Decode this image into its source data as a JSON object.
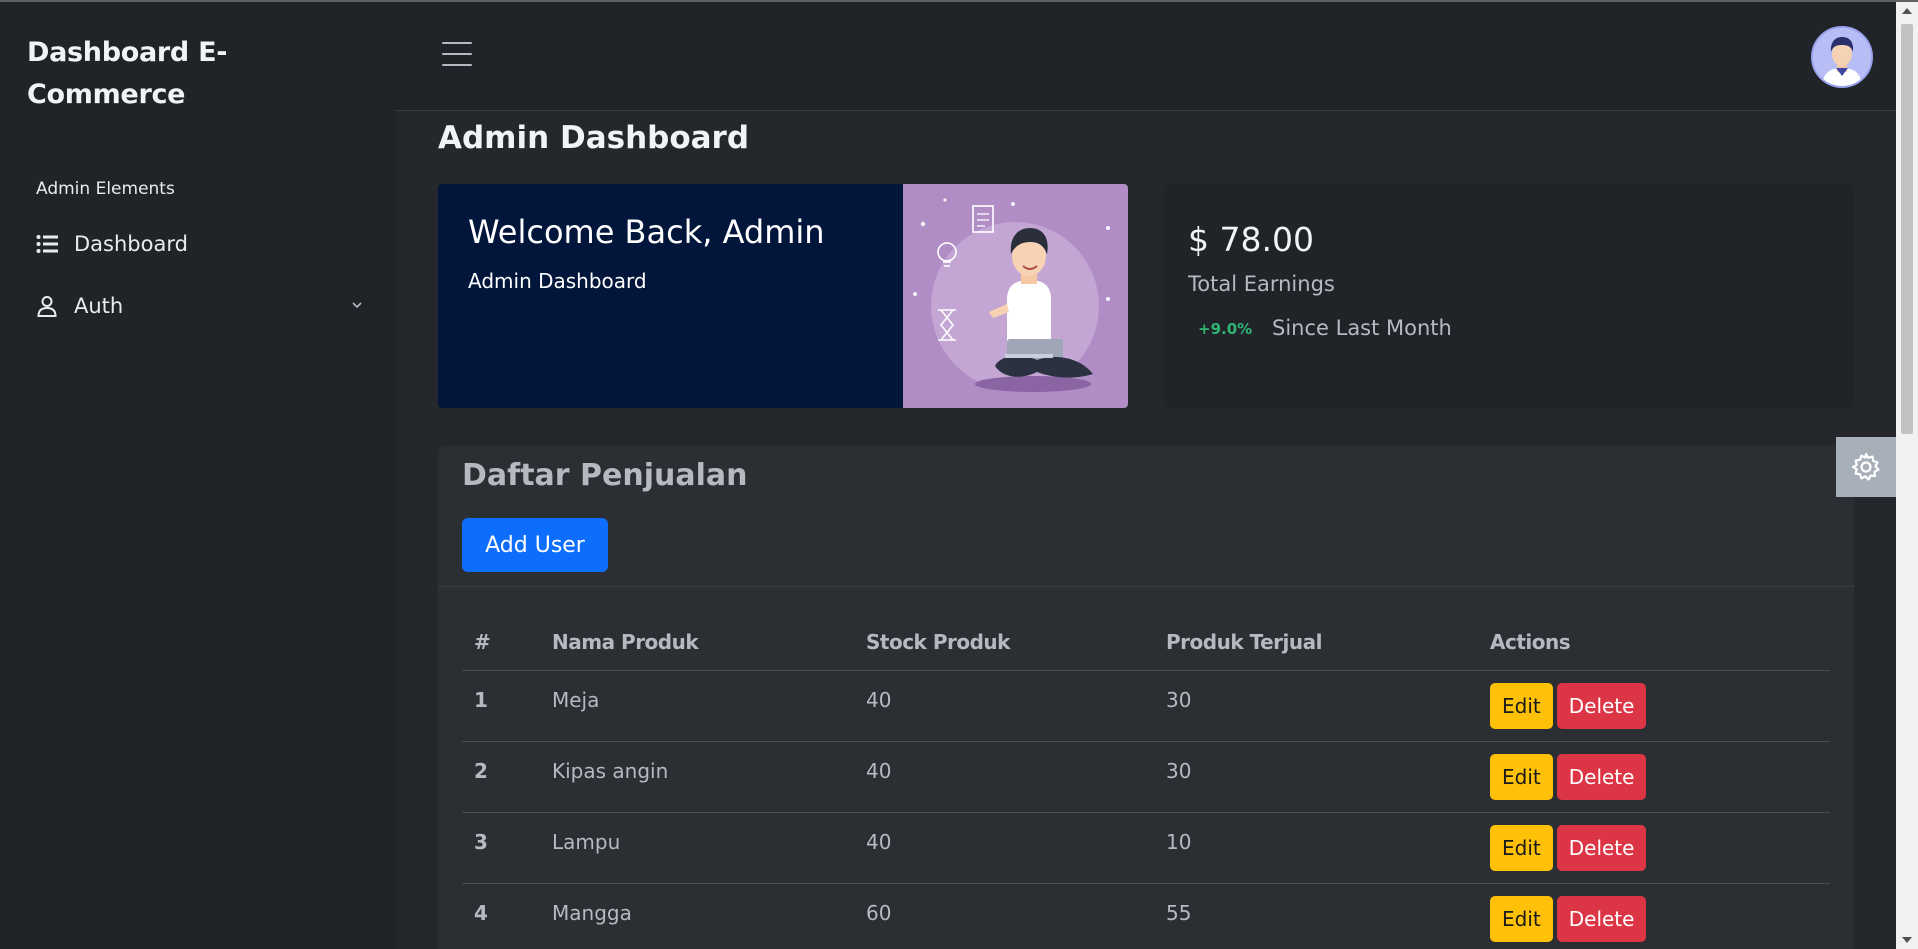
{
  "sidebar": {
    "brand": "Dashboard E-Commerce",
    "section_label": "Admin Elements",
    "items": [
      {
        "label": "Dashboard",
        "icon": "list-icon"
      },
      {
        "label": "Auth",
        "icon": "user-icon",
        "has_dropdown": true
      }
    ]
  },
  "header": {
    "menu_icon": "hamburger-icon",
    "avatar": "avatar"
  },
  "page": {
    "title": "Admin Dashboard"
  },
  "welcome": {
    "title": "Welcome Back, Admin",
    "subtitle": "Admin Dashboard",
    "illustration": "person-with-laptop-illustration"
  },
  "earnings": {
    "amount": "$ 78.00",
    "label": "Total Earnings",
    "change": "+9.0%",
    "since": "Since Last Month",
    "change_color": "#2fb574"
  },
  "sales": {
    "title": "Daftar Penjualan",
    "add_button": "Add User",
    "columns": [
      "#",
      "Nama Produk",
      "Stock Produk",
      "Produk Terjual",
      "Actions"
    ],
    "rows": [
      {
        "no": "1",
        "name": "Meja",
        "stock": "40",
        "sold": "30"
      },
      {
        "no": "2",
        "name": "Kipas angin",
        "stock": "40",
        "sold": "30"
      },
      {
        "no": "3",
        "name": "Lampu",
        "stock": "40",
        "sold": "10"
      },
      {
        "no": "4",
        "name": "Mangga",
        "stock": "60",
        "sold": "55"
      }
    ],
    "edit_label": "Edit",
    "delete_label": "Delete"
  },
  "colors": {
    "primary": "#0d6efd",
    "warning": "#ffc107",
    "danger": "#dc3545",
    "welcome_bg": "#01163a",
    "illustration_bg": "#b18dc6"
  }
}
